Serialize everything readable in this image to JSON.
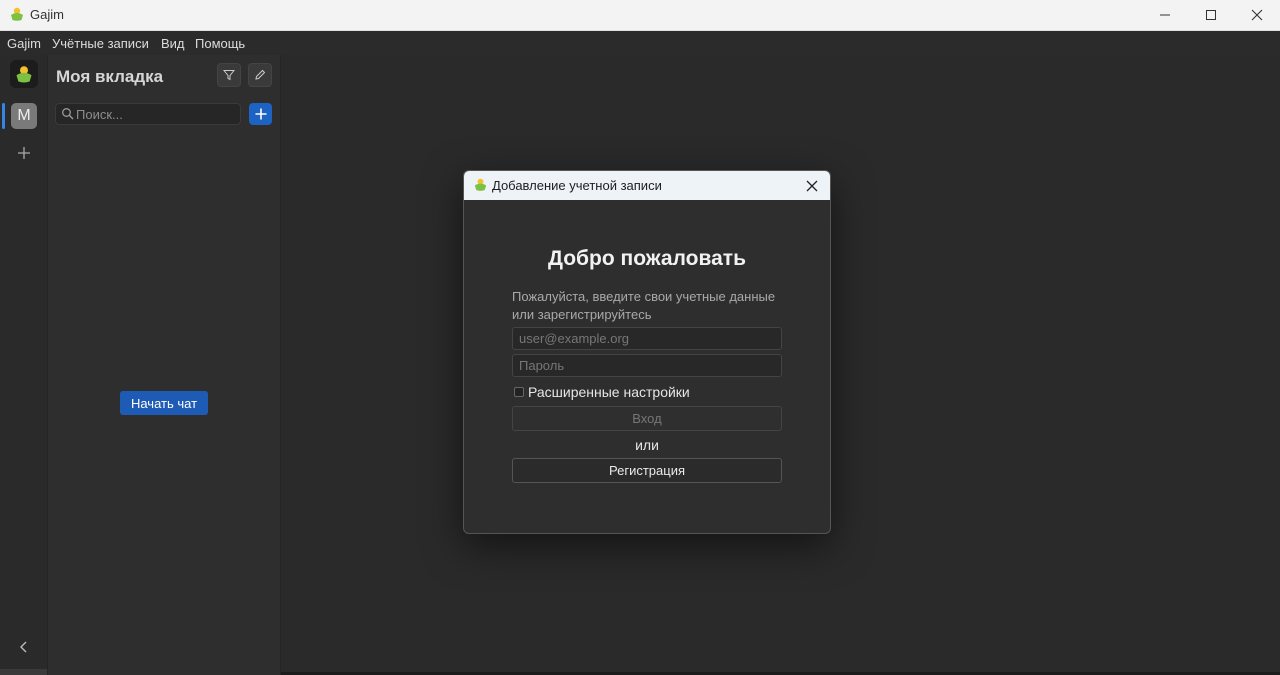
{
  "window": {
    "title": "Gajim"
  },
  "menu": [
    "Gajim",
    "Учётные записи",
    "Вид",
    "Помощь"
  ],
  "rail": {
    "avatar_letter": "M"
  },
  "sidebar": {
    "workspace_title": "Моя вкладка",
    "search_placeholder": "Поиск...",
    "start_chat_label": "Начать чат"
  },
  "dialog": {
    "title": "Добавление учетной записи",
    "welcome": "Добро пожаловать",
    "instructions": "Пожалуйста, введите свои учетные данные или зарегистрируйтесь",
    "jid_placeholder": "user@example.org",
    "password_placeholder": "Пароль",
    "advanced_label": "Расширенные настройки",
    "advanced_checked": false,
    "login_label": "Вход",
    "or_label": "или",
    "register_label": "Регистрация"
  },
  "colors": {
    "accent": "#1c63c4",
    "start_chat": "#1d5bb5",
    "background": "#2a2a2a",
    "logo_green": "#7cc142",
    "logo_yellow": "#f2c12e"
  }
}
